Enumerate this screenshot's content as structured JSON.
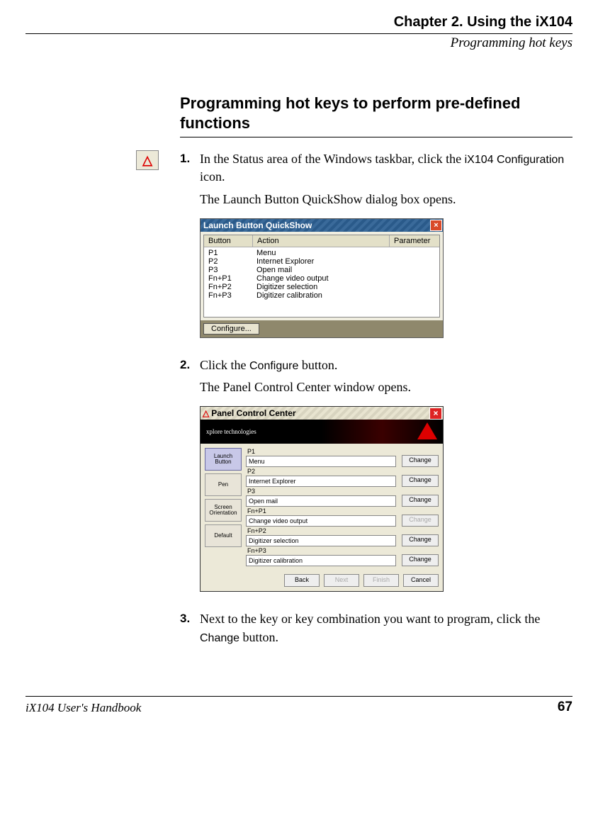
{
  "header": {
    "chapter": "Chapter 2. Using the iX104",
    "section": "Programming hot keys"
  },
  "heading": "Programming hot keys to perform pre-defined functions",
  "steps": {
    "s1": {
      "num": "1.",
      "text_a": "In the Status area of the Windows taskbar, click the ",
      "text_b": "iX104 Configuration",
      "text_c": " icon.",
      "follow": "The Launch Button QuickShow dialog box opens."
    },
    "s2": {
      "num": "2.",
      "text_a": "Click the ",
      "text_b": "Configure",
      "text_c": " button.",
      "follow": "The Panel Control Center window opens."
    },
    "s3": {
      "num": "3.",
      "text_a": "Next to the key or key combination you want to program, click the ",
      "text_b": "Change",
      "text_c": " button."
    }
  },
  "quickshow": {
    "title": "Launch Button QuickShow",
    "cols": {
      "a": "Button",
      "b": "Action",
      "c": "Parameter"
    },
    "rows": [
      {
        "a": "P1",
        "b": "Menu"
      },
      {
        "a": "P2",
        "b": "Internet Explorer"
      },
      {
        "a": "P3",
        "b": "Open mail"
      },
      {
        "a": "Fn+P1",
        "b": "Change video output"
      },
      {
        "a": "Fn+P2",
        "b": "Digitizer selection"
      },
      {
        "a": "Fn+P3",
        "b": "Digitizer calibration"
      }
    ],
    "configure": "Configure..."
  },
  "pcc": {
    "title": "Panel Control Center",
    "brand": "xplore technologies",
    "tabs": [
      "Launch\nButton",
      "Pen",
      "Screen\nOrientation",
      "Default"
    ],
    "entries": [
      {
        "key": "P1",
        "val": "Menu",
        "btn": "Change",
        "enabled": true
      },
      {
        "key": "P2",
        "val": "Internet Explorer",
        "btn": "Change",
        "enabled": true
      },
      {
        "key": "P3",
        "val": "Open mail",
        "btn": "Change",
        "enabled": true
      },
      {
        "key": "Fn+P1",
        "val": "Change video output",
        "btn": "Change",
        "enabled": false
      },
      {
        "key": "Fn+P2",
        "val": "Digitizer selection",
        "btn": "Change",
        "enabled": true
      },
      {
        "key": "Fn+P3",
        "val": "Digitizer calibration",
        "btn": "Change",
        "enabled": true
      }
    ],
    "footer": {
      "back": "Back",
      "next": "Next",
      "finish": "Finish",
      "cancel": "Cancel"
    }
  },
  "footer": {
    "left": "iX104 User's Handbook",
    "right": "67"
  }
}
